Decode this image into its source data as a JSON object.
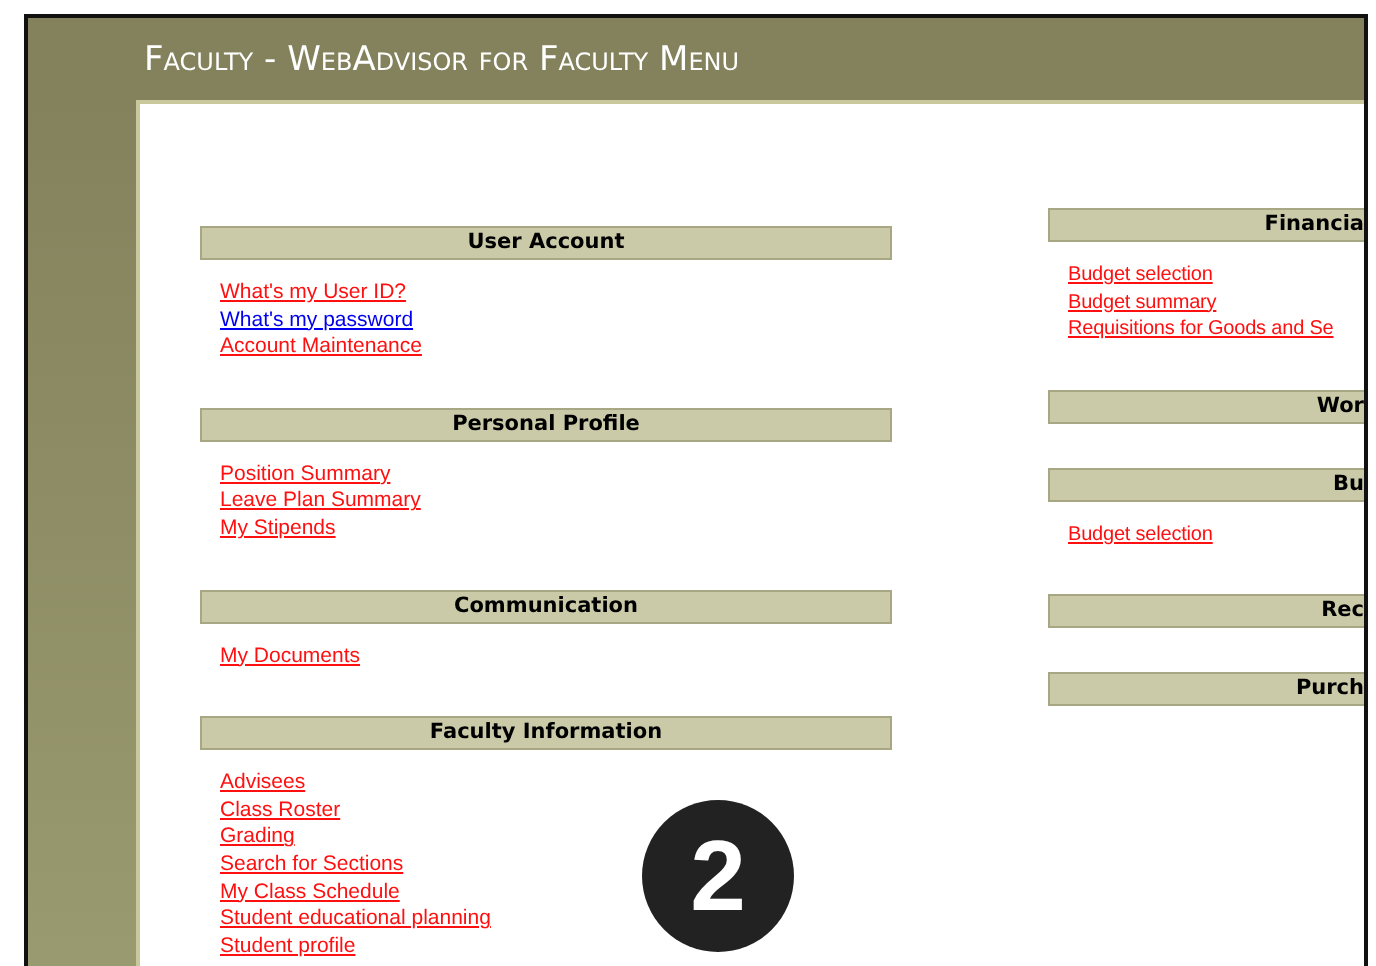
{
  "window": {
    "title": "Faculty - WebAdvisor for Faculty Menu"
  },
  "left_column": [
    {
      "heading": "User Account",
      "links": [
        {
          "label": "What's my User ID?",
          "visited": true
        },
        {
          "label": "What's my password",
          "visited": false
        },
        {
          "label": "Account Maintenance",
          "visited": true
        }
      ]
    },
    {
      "heading": "Personal Profile",
      "links": [
        {
          "label": "Position Summary",
          "visited": true
        },
        {
          "label": "Leave Plan Summary",
          "visited": true
        },
        {
          "label": "My Stipends",
          "visited": true
        }
      ]
    },
    {
      "heading": "Communication",
      "links": [
        {
          "label": "My Documents",
          "visited": true
        }
      ]
    },
    {
      "heading": "Faculty Information",
      "links": [
        {
          "label": "Advisees",
          "visited": true
        },
        {
          "label": "Class Roster",
          "visited": true
        },
        {
          "label": "Grading",
          "visited": true
        },
        {
          "label": "Search for Sections",
          "visited": true
        },
        {
          "label": "My Class Schedule",
          "visited": true
        },
        {
          "label": "Student educational planning",
          "visited": true
        },
        {
          "label": "Student profile",
          "visited": true
        }
      ]
    }
  ],
  "right_column": [
    {
      "heading": "Financia",
      "links": [
        {
          "label": "Budget selection",
          "visited": true
        },
        {
          "label": "Budget summary",
          "visited": true
        },
        {
          "label": "Requisitions for Goods and Se",
          "visited": true
        }
      ]
    },
    {
      "heading": "Wor"
    },
    {
      "heading": "Bu",
      "links": [
        {
          "label": "Budget selection",
          "visited": true
        }
      ]
    },
    {
      "heading": "Rec"
    },
    {
      "heading": "Purch"
    }
  ],
  "step_badge": "2"
}
